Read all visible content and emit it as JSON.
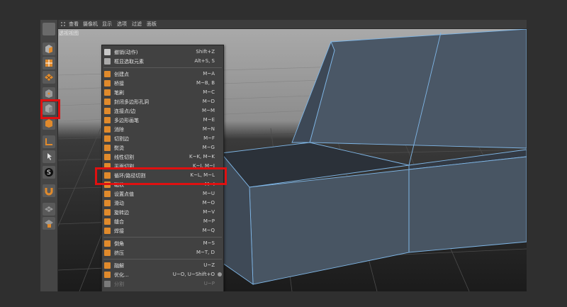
{
  "menubar": {
    "items": [
      "查看",
      "摄像机",
      "显示",
      "选项",
      "过滤",
      "面板"
    ]
  },
  "viewport": {
    "label": "透视视图"
  },
  "popup_menu": {
    "items": [
      {
        "label": "撤销(动作)",
        "shortcut": "Shift+Z",
        "icon": "undo-icon",
        "color": "#c8c8c8"
      },
      {
        "label": "框显选取元素",
        "shortcut": "Alt+S, S",
        "icon": "frame-icon",
        "color": "#aaaaaa"
      },
      {
        "label": "创建点",
        "shortcut": "M~A",
        "icon": "create-point-icon",
        "color": "#e08a2c"
      },
      {
        "label": "桥接",
        "shortcut": "M~B, B",
        "icon": "bridge-icon",
        "color": "#e08a2c"
      },
      {
        "label": "笔刷",
        "shortcut": "M~C",
        "icon": "brush-icon",
        "color": "#e08a2c"
      },
      {
        "label": "封闭多边形孔洞",
        "shortcut": "M~D",
        "icon": "close-hole-icon",
        "color": "#e08a2c"
      },
      {
        "label": "连接点/边",
        "shortcut": "M~M",
        "icon": "connect-icon",
        "color": "#e08a2c"
      },
      {
        "label": "多边形画笔",
        "shortcut": "M~E",
        "icon": "polygon-pen-icon",
        "color": "#e08a2c"
      },
      {
        "label": "消除",
        "shortcut": "M~N",
        "icon": "dissolve-icon",
        "color": "#e08a2c"
      },
      {
        "label": "切割边",
        "shortcut": "M~F",
        "icon": "edge-cut-icon",
        "color": "#e08a2c"
      },
      {
        "label": "熨烫",
        "shortcut": "M~G",
        "icon": "iron-icon",
        "color": "#e08a2c"
      },
      {
        "label": "线性切割",
        "shortcut": "K~K, M~K",
        "icon": "line-cut-icon",
        "color": "#e08a2c"
      },
      {
        "label": "平面切割",
        "shortcut": "K~J, M~J",
        "icon": "plane-cut-icon",
        "color": "#e08a2c"
      },
      {
        "label": "循环/路径切割",
        "shortcut": "K~L, M~L",
        "icon": "loop-cut-icon",
        "color": "#e08a2c"
      },
      {
        "label": "磁铁",
        "shortcut": "M~I",
        "icon": "magnet-icon",
        "color": "#e08a2c"
      },
      {
        "label": "设置点值",
        "shortcut": "M~U",
        "icon": "set-point-icon",
        "color": "#e08a2c"
      },
      {
        "label": "滑动",
        "shortcut": "M~O",
        "icon": "slide-icon",
        "color": "#e08a2c"
      },
      {
        "label": "旋转边",
        "shortcut": "M~V",
        "icon": "spin-edge-icon",
        "color": "#e08a2c"
      },
      {
        "label": "缝合",
        "shortcut": "M~P",
        "icon": "stitch-icon",
        "color": "#e08a2c"
      },
      {
        "label": "焊接",
        "shortcut": "M~Q",
        "icon": "weld-icon",
        "color": "#e08a2c"
      },
      {
        "label": "倒角",
        "shortcut": "M~S",
        "icon": "bevel-icon",
        "color": "#e08a2c"
      },
      {
        "label": "挤压",
        "shortcut": "M~T, D",
        "icon": "extrude-icon",
        "color": "#e08a2c"
      },
      {
        "label": "融解",
        "shortcut": "U~Z",
        "icon": "melt-icon",
        "color": "#e08a2c"
      },
      {
        "label": "优化...",
        "shortcut": "U~O, U~Shift+O",
        "icon": "optimize-icon",
        "color": "#e08a2c"
      },
      {
        "label": "分割",
        "shortcut": "U~P",
        "icon": "split-icon",
        "color": "#7a7a7a",
        "disabled": true
      }
    ]
  },
  "colors": {
    "highlight": "#e01010",
    "accent": "#e08a2c",
    "mesh": "#485563",
    "wire": "#6fa8dc"
  }
}
